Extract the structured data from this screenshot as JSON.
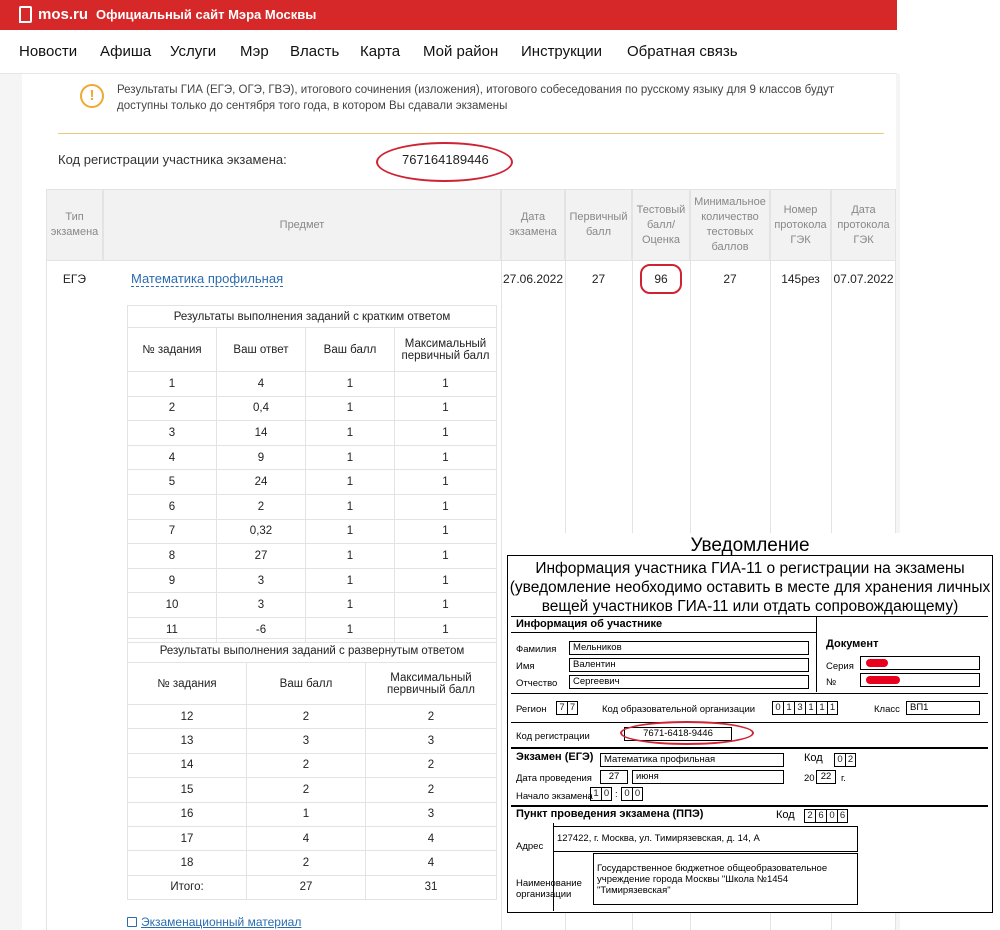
{
  "header": {
    "logo": "mos.ru",
    "title": "Официальный сайт Мэра Москвы"
  },
  "nav": [
    "Новости",
    "Афиша",
    "Услуги",
    "Мэр",
    "Власть",
    "Карта",
    "Мой район",
    "Инструкции",
    "Обратная связь"
  ],
  "notice": "Результаты ГИА (ЕГЭ, ОГЭ, ГВЭ), итогового сочинения (изложения), итогового собеседования по русскому языку для 9 классов будут доступны только до сентября того года, в котором Вы сдавали экзамены",
  "registration": {
    "label": "Код регистрации участника экзамена:",
    "code": "767164189446"
  },
  "table_headers": [
    "Тип экзамена",
    "Предмет",
    "Дата экзамена",
    "Первичный балл",
    "Тестовый балл/ Оценка",
    "Минимальное количество тестовых баллов",
    "Номер протокола ГЭК",
    "Дата протокола ГЭК"
  ],
  "result": {
    "type": "ЕГЭ",
    "subject": "Математика профильная",
    "date": "27.06.2022",
    "primary": "27",
    "test_score": "96",
    "min_score": "27",
    "protocol": "145рез",
    "protocol_date": "07.07.2022"
  },
  "short_answers": {
    "title": "Результаты выполнения заданий с кратким ответом",
    "headers": [
      "№ задания",
      "Ваш ответ",
      "Ваш балл",
      "Максимальный первичный балл"
    ],
    "rows": [
      [
        "1",
        "4",
        "1",
        "1"
      ],
      [
        "2",
        "0,4",
        "1",
        "1"
      ],
      [
        "3",
        "14",
        "1",
        "1"
      ],
      [
        "4",
        "9",
        "1",
        "1"
      ],
      [
        "5",
        "24",
        "1",
        "1"
      ],
      [
        "6",
        "2",
        "1",
        "1"
      ],
      [
        "7",
        "0,32",
        "1",
        "1"
      ],
      [
        "8",
        "27",
        "1",
        "1"
      ],
      [
        "9",
        "3",
        "1",
        "1"
      ],
      [
        "10",
        "3",
        "1",
        "1"
      ],
      [
        "11",
        "-6",
        "1",
        "1"
      ]
    ]
  },
  "long_answers": {
    "title": "Результаты выполнения заданий с развернутым ответом",
    "headers": [
      "№ задания",
      "Ваш балл",
      "Максимальный первичный балл"
    ],
    "rows": [
      [
        "12",
        "2",
        "2"
      ],
      [
        "13",
        "3",
        "3"
      ],
      [
        "14",
        "2",
        "2"
      ],
      [
        "15",
        "2",
        "2"
      ],
      [
        "16",
        "1",
        "3"
      ],
      [
        "17",
        "4",
        "4"
      ],
      [
        "18",
        "2",
        "4"
      ]
    ],
    "total": [
      "Итого:",
      "27",
      "31"
    ]
  },
  "exam_material_link": "Экзаменационный материал",
  "notification": {
    "title": "Уведомление",
    "heading": "Информация участника ГИА-11 о регистрации на экзамены (уведомление необходимо оставить в месте для хранения личных вещей участников ГИА-11 или отдать сопровождающему)",
    "participant_section": "Информация об участнике",
    "surname_label": "Фамилия",
    "surname": "Мельников",
    "name_label": "Имя",
    "name": "Валентин",
    "patronymic_label": "Отчество",
    "patronymic": "Сергеевич",
    "doc_section": "Документ",
    "series_label": "Серия",
    "number_label": "№",
    "region_label": "Регион",
    "region": [
      "7",
      "7"
    ],
    "org_code_label": "Код образовательной организации",
    "org_code": [
      "0",
      "1",
      "3",
      "1",
      "1",
      "1"
    ],
    "class_label": "Класс",
    "class": "ВП1",
    "reg_code_label": "Код регистрации",
    "reg_code": "7671-6418-9446",
    "exam_section": "Экзамен (ЕГЭ)",
    "exam_subject": "Математика профильная",
    "code_label": "Код",
    "exam_code": [
      "0",
      "2"
    ],
    "date_label": "Дата проведения",
    "day": "27",
    "month": "июня",
    "year_prefix": "20",
    "year_suffix": "22",
    "year_unit": "г.",
    "start_label": "Начало экзамена",
    "start_hour": [
      "1",
      "0"
    ],
    "start_colon": ":",
    "start_min": [
      "0",
      "0"
    ],
    "ppe_section": "Пункт проведения экзамена (ППЭ)",
    "ppe_code": [
      "2",
      "6",
      "0",
      "6"
    ],
    "address_label": "Адрес",
    "address": "127422, г. Москва, ул. Тимирязевская, д. 14, А",
    "org_name_label": "Наименование организации",
    "org_name": "Государственное бюджетное общеобразовательное учреждение города Москвы \"Школа №1454 \"Тимирязевская\"",
    "colors": {
      "redaction": "#e8001c"
    }
  },
  "colors": {
    "brand": "#d62828",
    "link": "#2b6cb0",
    "highlight": "#cf2233",
    "notice": "#f0a830"
  }
}
